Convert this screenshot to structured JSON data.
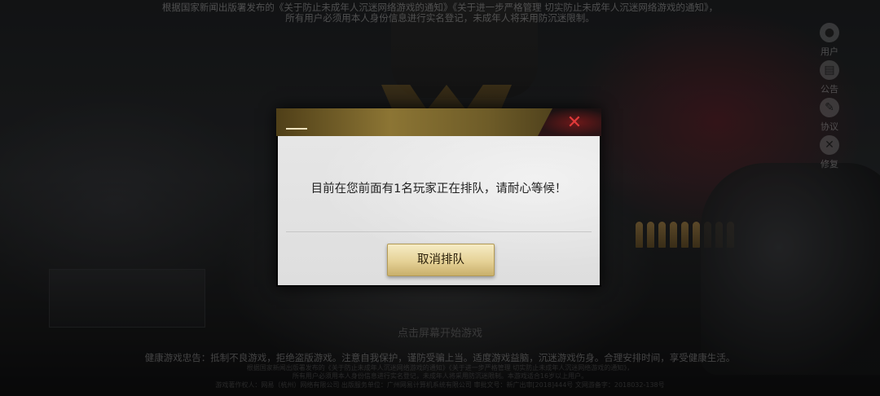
{
  "background": {
    "notice_line1": "根据国家新闻出版署发布的《关于防止未成年人沉迷网络游戏的通知》《关于进一步严格管理 切实防止未成年人沉迷网络游戏的通知》，",
    "notice_line2": "所有用户必须用本人身份信息进行实名登记，未成年人将采用防沉迷限制。",
    "tap_hint": "点击屏幕开始游戏",
    "health_advice": "健康游戏忠告：抵制不良游戏，拒绝盗版游戏。注意自我保护，谨防受骗上当。适度游戏益脑，沉迷游戏伤身。合理安排时间，享受健康生活。",
    "fine_print_1": "根据国家新闻出版署发布的《关于防止未成年人沉迷网络游戏的通知》《关于进一步严格管理 切实防止未成年人沉迷网络游戏的通知》，",
    "fine_print_2": "所有用户必须用本人身份信息进行实名登记，未成年人将采用防沉迷限制。本游戏适合16岁以上用户。",
    "fine_print_3": "游戏著作权人：网易（杭州）网络有限公司 出版服务单位：广州网易计算机系统有限公司 审批文号：新广出审[2018]444号 文网游备字：2018032-138号"
  },
  "side_menu": [
    {
      "label": "用户",
      "icon": "user-icon",
      "glyph": "●"
    },
    {
      "label": "公告",
      "icon": "announcement-icon",
      "glyph": "▤"
    },
    {
      "label": "协议",
      "icon": "agreement-icon",
      "glyph": "✎"
    },
    {
      "label": "修复",
      "icon": "repair-icon",
      "glyph": "✕"
    }
  ],
  "dialog": {
    "message": "目前在您前面有1名玩家正在排队，请耐心等候！",
    "close_glyph": "✕",
    "cancel_label": "取消排队"
  },
  "colors": {
    "header_gold": "#8c7534",
    "close_red": "#e03a3a",
    "button_gold": "#e5d196"
  }
}
